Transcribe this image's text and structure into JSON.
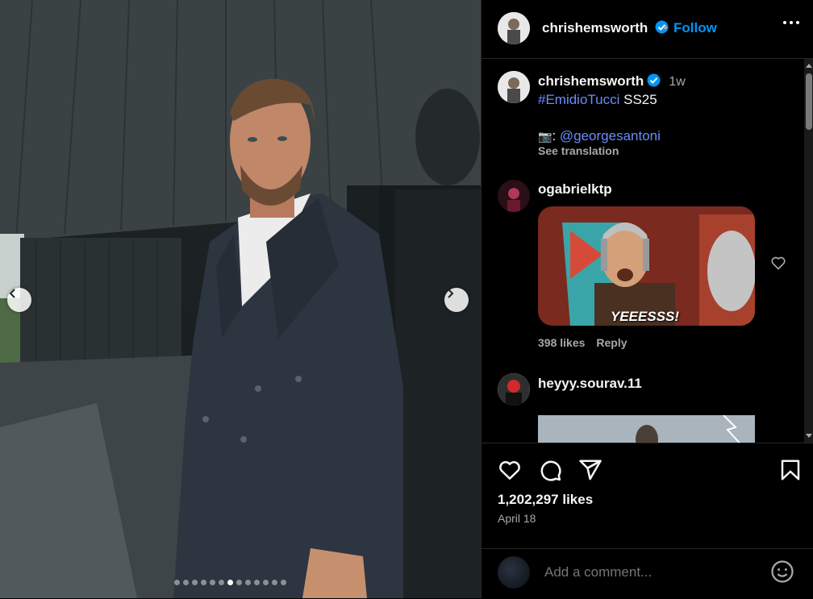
{
  "post": {
    "username": "chrishemsworth",
    "follow_label": "Follow",
    "separator": "•",
    "caption": {
      "username": "chrishemsworth",
      "time": "1w",
      "hashtag": "#EmidioTucci",
      "text_after_hashtag": " SS25",
      "camera_emoji": "📷",
      "credit_prefix": ": ",
      "credit_mention": "@georgesantoni",
      "see_translation": "See translation"
    },
    "comments": [
      {
        "username": "ogabrielktp",
        "gif_caption": "YEEESSS!",
        "likes": "398 likes",
        "reply_label": "Reply"
      },
      {
        "username": "heyyy.sourav.11"
      }
    ],
    "likes": "1,202,297 likes",
    "date": "April 18",
    "add_comment_placeholder": "Add a comment...",
    "carousel": {
      "total": 13,
      "active_index": 6
    }
  },
  "colors": {
    "accent": "#0095f6",
    "link": "#6b8cff",
    "muted": "#a8a8a8",
    "background": "#000000"
  },
  "icons": [
    "verified-badge-icon",
    "more-options-icon",
    "heart-icon",
    "comment-icon",
    "share-icon",
    "bookmark-icon",
    "emoji-icon",
    "chevron-left-icon",
    "chevron-right-icon"
  ]
}
